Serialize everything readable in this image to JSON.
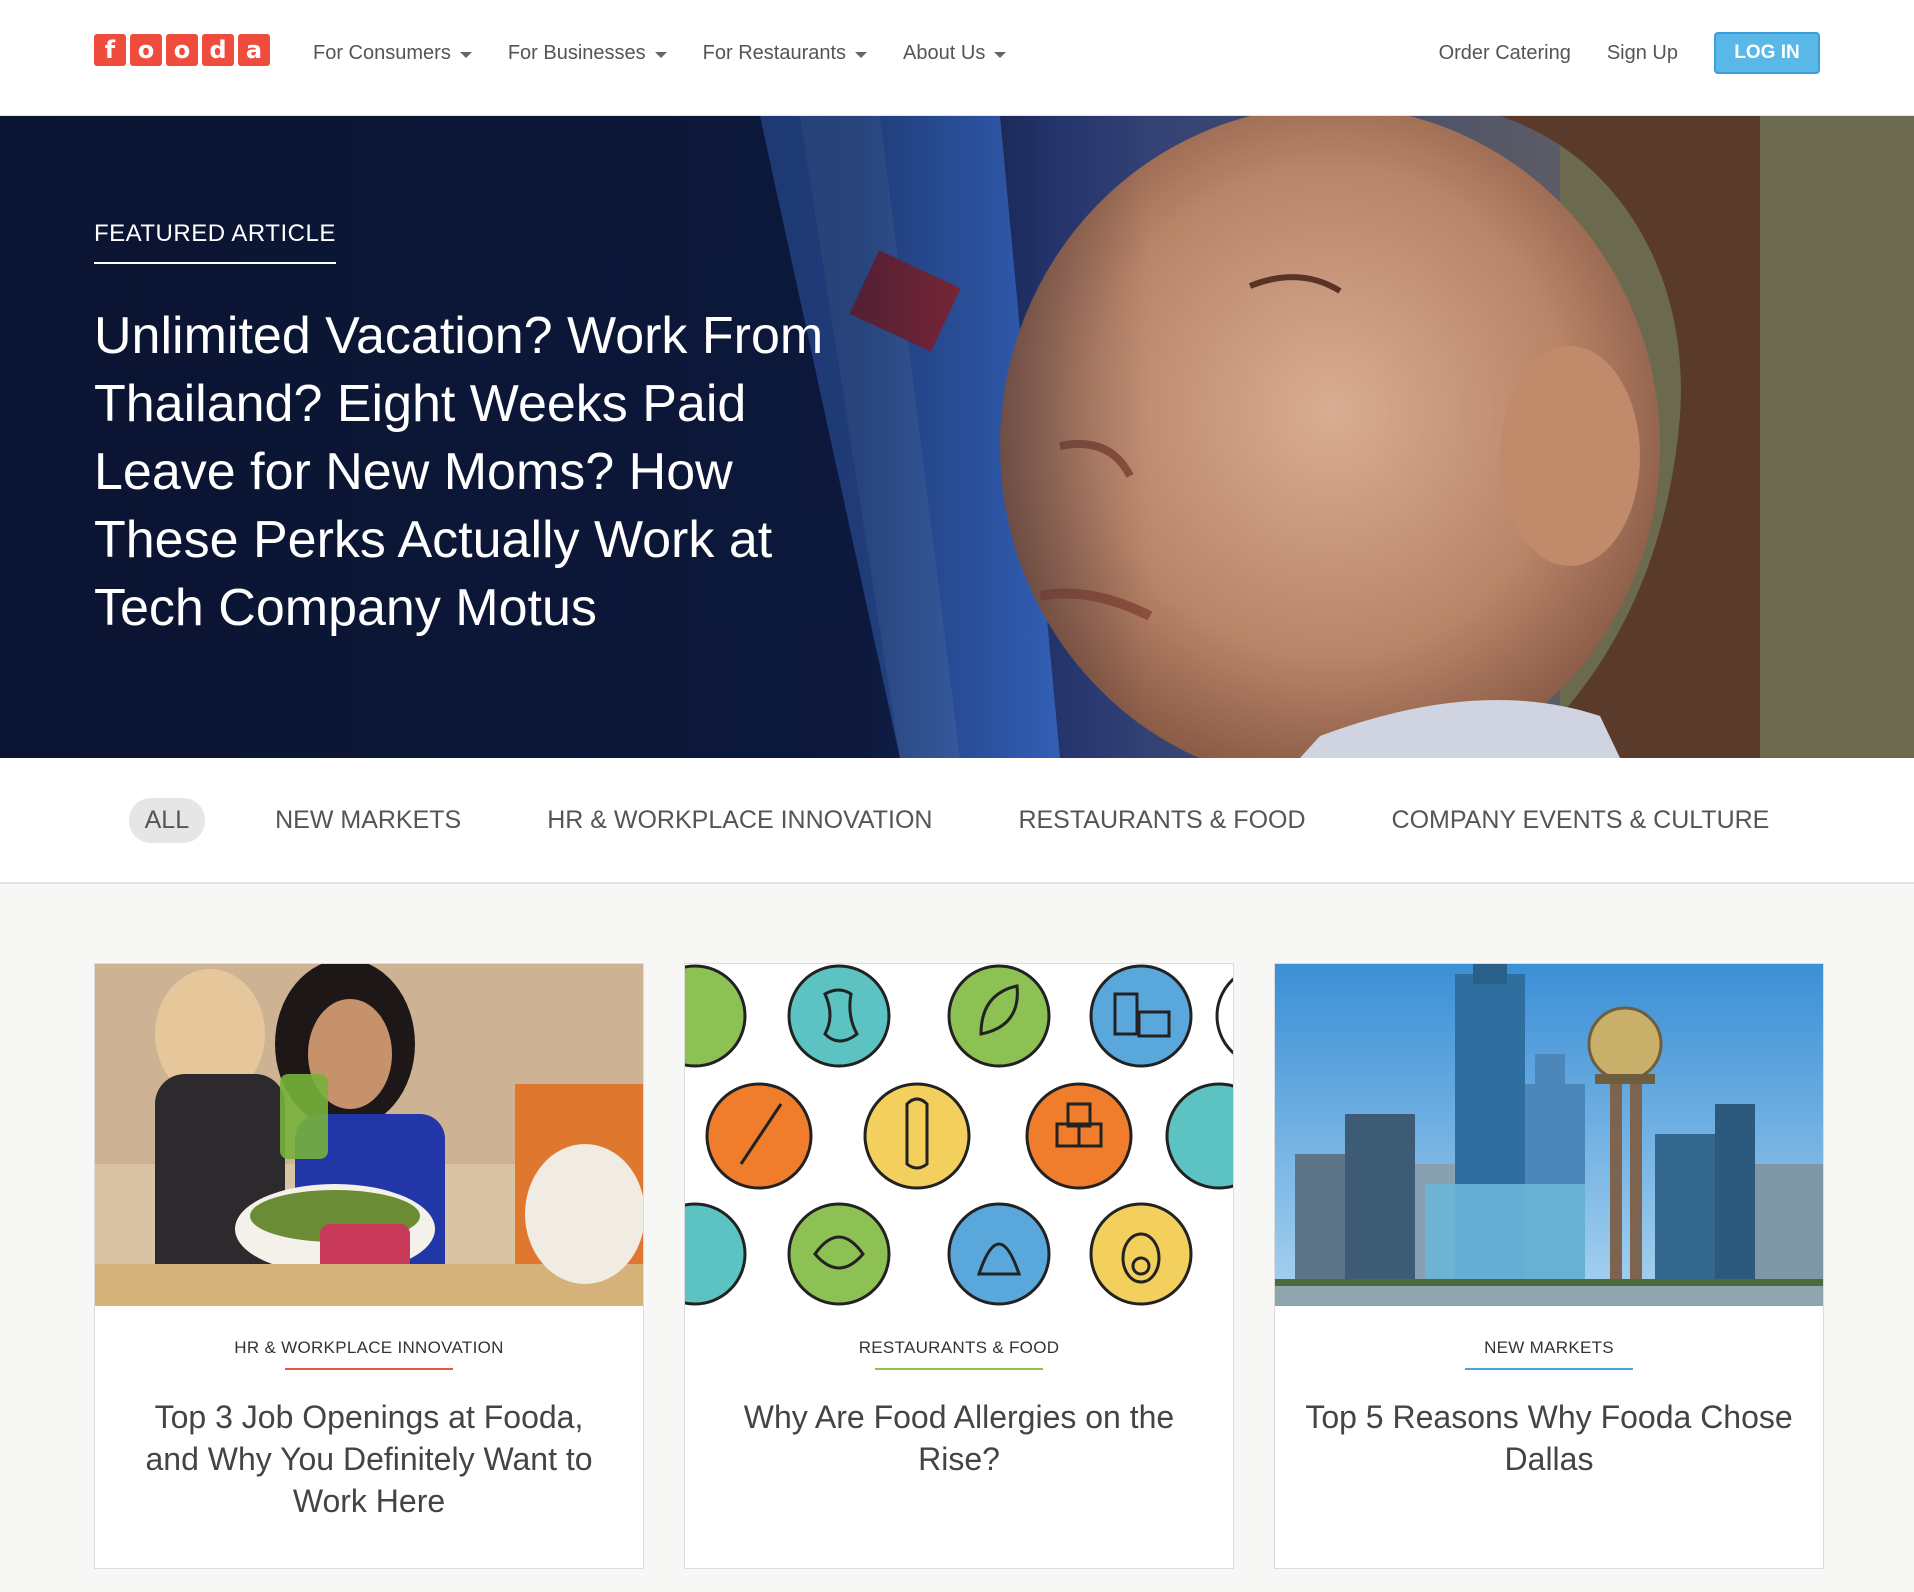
{
  "brand": {
    "logo_letters": [
      "f",
      "o",
      "o",
      "d",
      "a"
    ],
    "logo_color": "#ef4c3d",
    "accent_blue": "#5ab8e8"
  },
  "nav": {
    "items": [
      {
        "label": "For Consumers"
      },
      {
        "label": "For Businesses"
      },
      {
        "label": "For Restaurants"
      },
      {
        "label": "About Us"
      }
    ],
    "order_catering": "Order Catering",
    "sign_up": "Sign Up",
    "log_in": "LOG IN"
  },
  "hero": {
    "label": "FEATURED ARTICLE",
    "title": "Unlimited Vacation? Work From Thailand? Eight Weeks Paid Leave for New Moms? How These Perks Actually Work at Tech Company Motus"
  },
  "filters": [
    {
      "label": "ALL",
      "active": true
    },
    {
      "label": "NEW MARKETS"
    },
    {
      "label": "HR & WORKPLACE INNOVATION"
    },
    {
      "label": "RESTAURANTS & FOOD"
    },
    {
      "label": "COMPANY EVENTS & CULTURE"
    }
  ],
  "cards": [
    {
      "category": "HR & WORKPLACE INNOVATION",
      "title": "Top 3 Job Openings at Fooda, and Why You Definitely Want to Work Here",
      "accent": "#e8573f"
    },
    {
      "category": "RESTAURANTS & FOOD",
      "title": "Why Are Food Allergies on the Rise?",
      "accent": "#8fc251"
    },
    {
      "category": "NEW MARKETS",
      "title": "Top 5 Reasons Why Fooda Chose Dallas",
      "accent": "#4aa8d8"
    }
  ]
}
